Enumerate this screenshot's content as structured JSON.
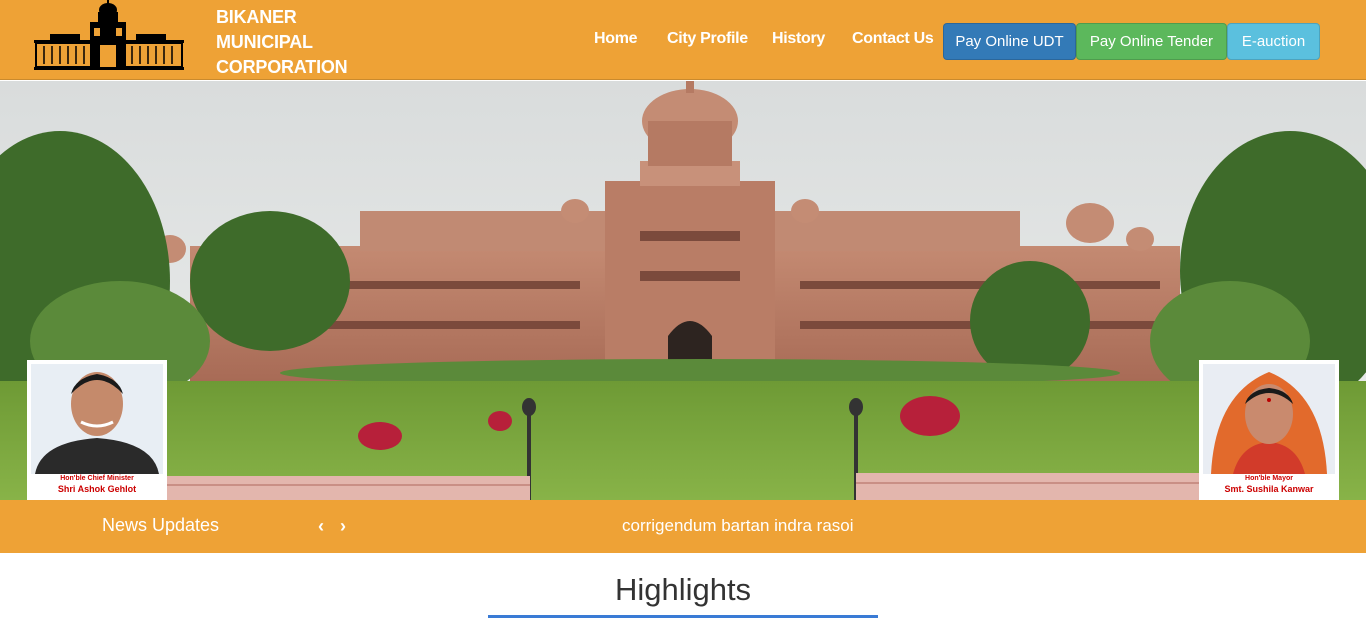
{
  "header": {
    "brand_line1": "BIKANER",
    "brand_line2": "MUNICIPAL",
    "brand_line3": "CORPORATION",
    "background": "#eea236"
  },
  "nav": {
    "home": "Home",
    "city_profile": "City Profile",
    "history": "History",
    "contact": "Contact Us"
  },
  "buttons": {
    "pay_udt": {
      "label": "Pay Online UDT",
      "color": "#337ab7"
    },
    "pay_tender": {
      "label": "Pay Online Tender",
      "color": "#5cb85c"
    },
    "eauction": {
      "label": "E-auction",
      "color": "#5bc0de"
    }
  },
  "slider": {
    "next_icon": "chevron-right-icon"
  },
  "portraits": {
    "left": {
      "role": "Hon'ble Chief Minister",
      "name": "Shri Ashok Gehlot"
    },
    "right": {
      "role": "Hon'ble Mayor",
      "name": "Smt. Sushila Kanwar"
    }
  },
  "news": {
    "title": "News Updates",
    "prev": "‹",
    "next": "›",
    "ticker": "corrigendum bartan indra rasoi"
  },
  "section": {
    "title": "Highlights",
    "underline_color": "#3a7bd5"
  }
}
